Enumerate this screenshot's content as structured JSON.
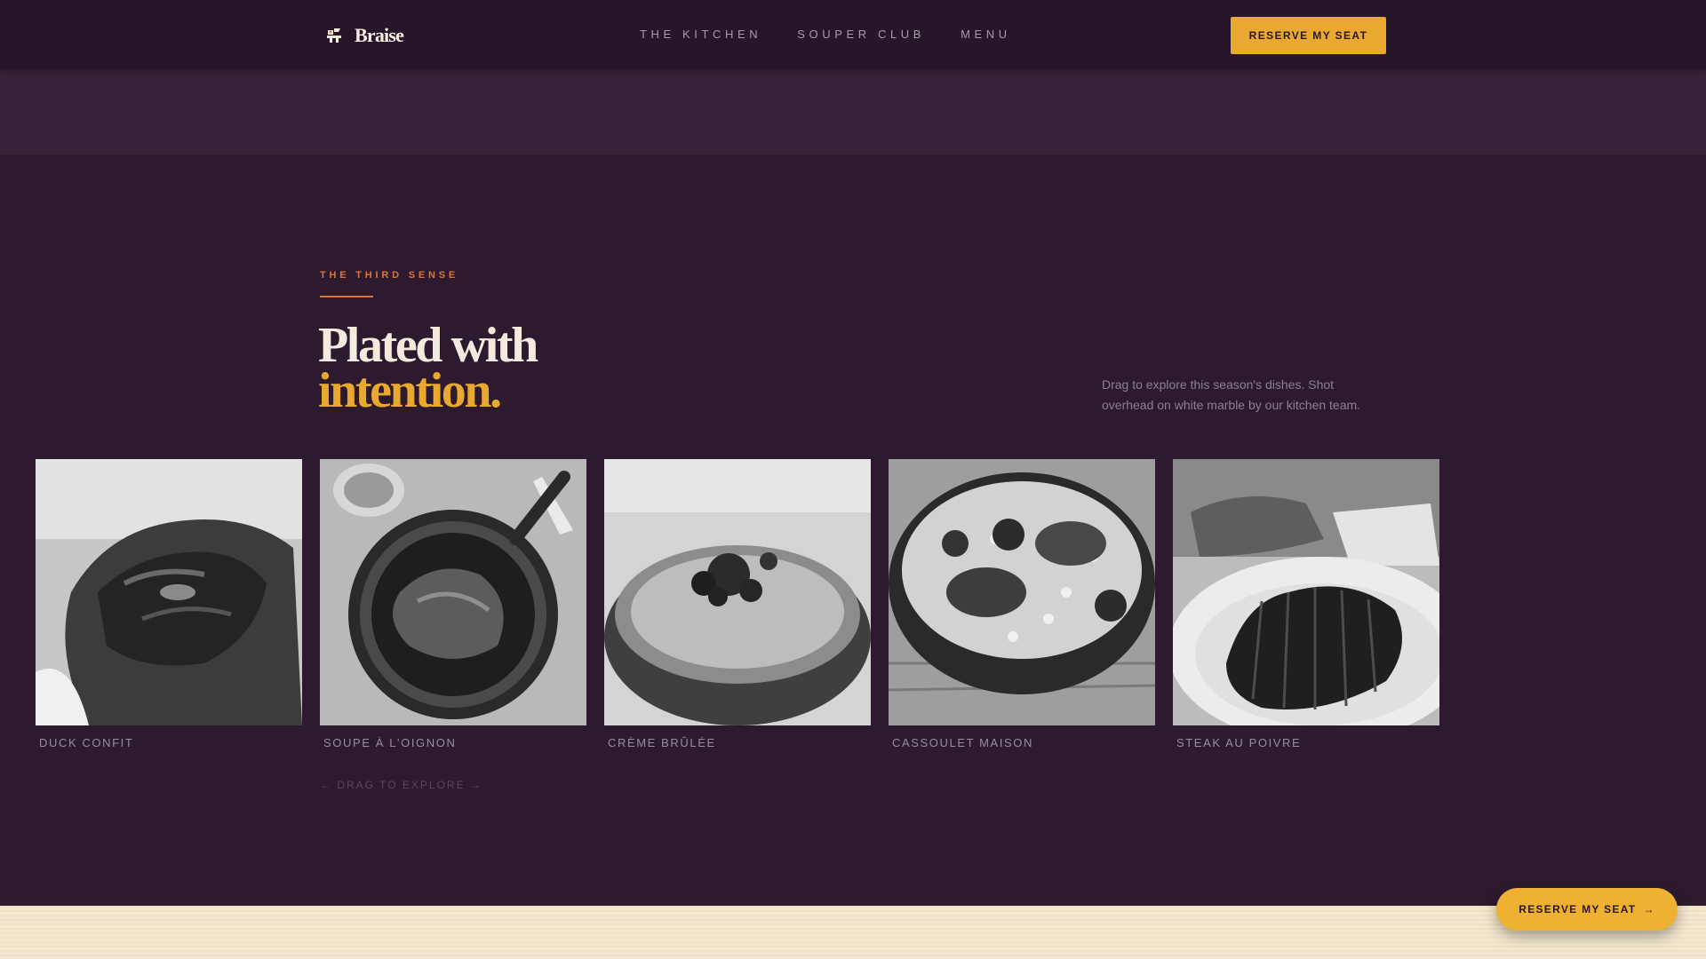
{
  "brand": {
    "name": "Braise",
    "icon": "chef-hat-icon"
  },
  "nav": {
    "links": [
      "THE KITCHEN",
      "SOUPER CLUB",
      "MENU"
    ],
    "cta": "RESERVE MY SEAT"
  },
  "section": {
    "eyebrow": "THE THIRD SENSE",
    "headline_line1": "Plated with",
    "headline_line2": "intention.",
    "blurb": "Drag to explore this season's dishes. Shot overhead on white marble by our kitchen team.",
    "drag_hint": "← DRAG TO EXPLORE →"
  },
  "dishes": [
    {
      "name": "DUCK CONFIT"
    },
    {
      "name": "SOUPE À L'OIGNON"
    },
    {
      "name": "CRÈME BRÛLÉE"
    },
    {
      "name": "CASSOULET MAISON"
    },
    {
      "name": "STEAK AU POIVRE"
    }
  ],
  "floating_cta": {
    "label": "RESERVE MY SEAT",
    "arrow": "→"
  },
  "colors": {
    "background": "#2d1a2e",
    "nav": "#27152a",
    "accent": "#e9a830",
    "eyebrow": "#d9753a",
    "cream": "#f3e7cf"
  }
}
